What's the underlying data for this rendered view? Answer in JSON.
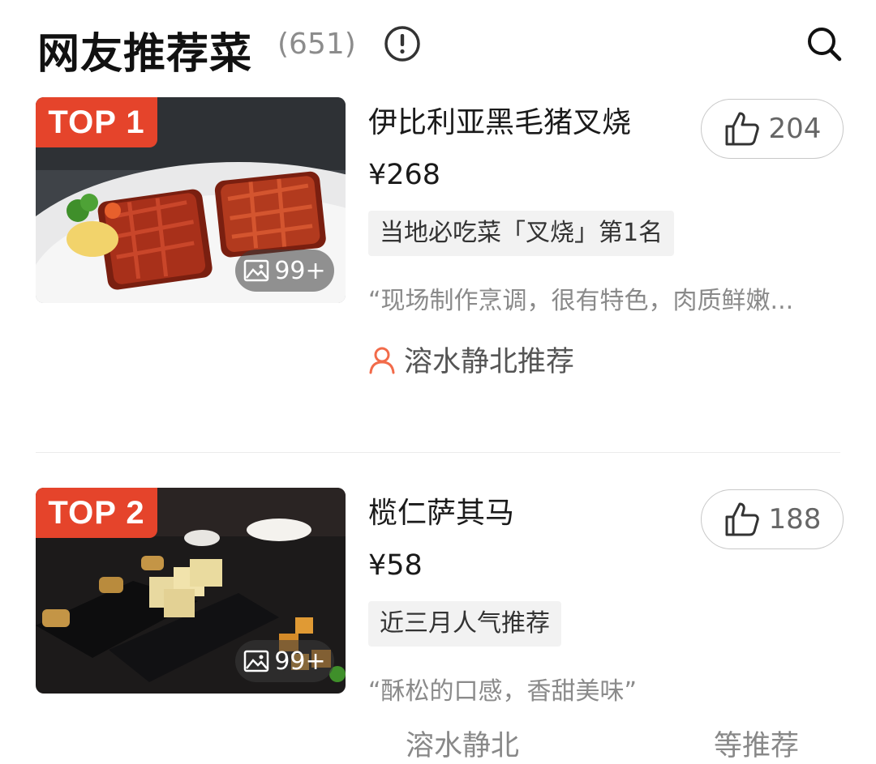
{
  "header": {
    "title": "网友推荐菜",
    "count": "(651)"
  },
  "dishes": [
    {
      "rank": "TOP 1",
      "name": "伊比利亚黑毛猪叉烧",
      "price": "¥268",
      "tag": "当地必吃菜「叉烧」第1名",
      "quote": "“现场制作烹调，很有特色，肉质鲜嫩...",
      "recommender": "溶水静北推荐",
      "likes": "204",
      "photo_count": "99+"
    },
    {
      "rank": "TOP 2",
      "name": "榄仁萨其马",
      "price": "¥58",
      "tag": "近三月人气推荐",
      "quote": "“酥松的口感，香甜美味”",
      "recommender": "溶水静北",
      "recommender_right": "等推荐",
      "likes": "188",
      "photo_count": "99+"
    }
  ],
  "colors": {
    "accent": "#e5442b",
    "recommender_icon": "#f26b4a"
  }
}
